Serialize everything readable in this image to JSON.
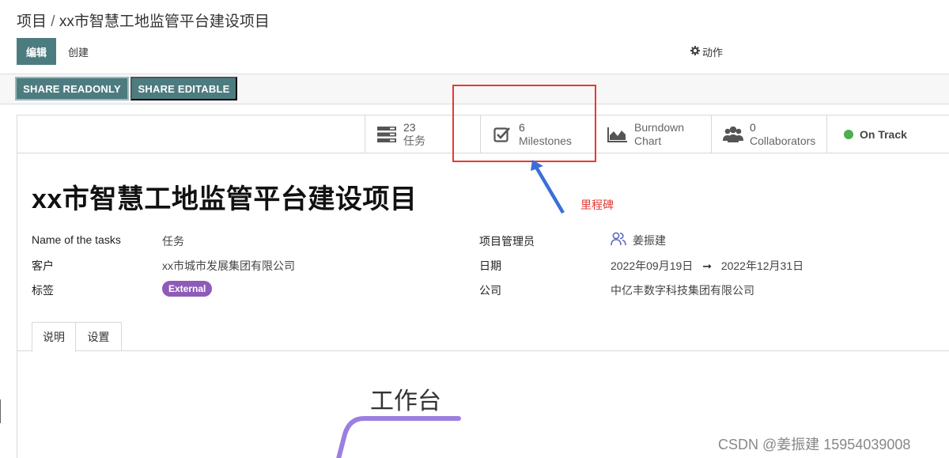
{
  "breadcrumb": {
    "root": "项目",
    "separator": "/",
    "current": "xx市智慧工地监管平台建设项目"
  },
  "toolbar": {
    "edit_label": "编辑",
    "create_label": "创建",
    "action_label": "动作",
    "action_icon": "gear-icon"
  },
  "share": {
    "readonly_label": "SHARE READONLY",
    "editable_label": "SHARE EDITABLE"
  },
  "stats": {
    "tasks": {
      "count": "23",
      "label": "任务",
      "icon": "tasks-icon"
    },
    "milestones": {
      "count": "6",
      "label": "Milestones",
      "icon": "checkbox-icon"
    },
    "burndown": {
      "line1": "Burndown",
      "line2": "Chart",
      "icon": "area-chart-icon"
    },
    "collaborators": {
      "count": "0",
      "label": "Collaborators",
      "icon": "users-icon"
    },
    "status": {
      "label": "On Track",
      "color": "#4caf50"
    }
  },
  "project": {
    "title": "xx市智慧工地监管平台建设项目",
    "fields": {
      "tasks_name_label": "Name of the tasks",
      "tasks_name_value": "任务",
      "customer_label": "客户",
      "customer_value": "xx市城市发展集团有限公司",
      "tags_label": "标签",
      "tag_value": "External",
      "manager_label": "项目管理员",
      "manager_value": "姜振建",
      "date_label": "日期",
      "date_start": "2022年09月19日",
      "date_arrow": "➞",
      "date_end": "2022年12月31日",
      "company_label": "公司",
      "company_value": "中亿丰数字科技集团有限公司"
    }
  },
  "tabs": [
    {
      "label": "说明",
      "active": true
    },
    {
      "label": "设置",
      "active": false
    }
  ],
  "description": {
    "canvas_title": "工作台"
  },
  "annotation": {
    "text": "里程碑",
    "color": "#e53935"
  },
  "watermark": "CSDN @姜振建 15954039008",
  "colors": {
    "primary": "#4d7c80",
    "tag": "#8e5cb8",
    "mindmap_line": "#9b7fe0",
    "arrow": "#3b6fd8"
  }
}
